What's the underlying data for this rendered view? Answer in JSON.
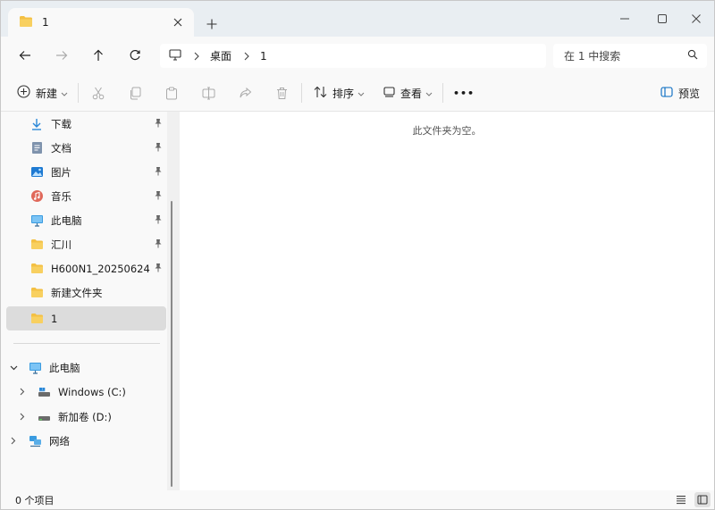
{
  "tab": {
    "title": "1"
  },
  "address": {
    "breadcrumbs": [
      "桌面",
      "1"
    ]
  },
  "search": {
    "placeholder": "在 1 中搜索"
  },
  "toolbar": {
    "new_label": "新建",
    "sort_label": "排序",
    "view_label": "查看",
    "more_label": "•••",
    "preview_label": "预览"
  },
  "sidebar": {
    "quick_access": [
      {
        "label": "下载",
        "icon": "download-icon",
        "pinned": true
      },
      {
        "label": "文档",
        "icon": "document-icon",
        "pinned": true
      },
      {
        "label": "图片",
        "icon": "pictures-icon",
        "pinned": true
      },
      {
        "label": "音乐",
        "icon": "music-icon",
        "pinned": true
      },
      {
        "label": "此电脑",
        "icon": "computer-icon",
        "pinned": true
      },
      {
        "label": "汇川",
        "icon": "folder-icon",
        "pinned": true
      },
      {
        "label": "H600N1_20250624",
        "icon": "folder-icon",
        "pinned": true
      },
      {
        "label": "新建文件夹",
        "icon": "folder-icon",
        "pinned": false
      },
      {
        "label": "1",
        "icon": "folder-icon",
        "pinned": false,
        "selected": true
      }
    ],
    "tree": [
      {
        "label": "此电脑",
        "icon": "computer-icon",
        "expanded": true
      },
      {
        "label": "Windows (C:)",
        "icon": "drive-icon"
      },
      {
        "label": "新加卷 (D:)",
        "icon": "drive-icon"
      },
      {
        "label": "网络",
        "icon": "network-icon"
      }
    ]
  },
  "content": {
    "empty_message": "此文件夹为空。"
  },
  "status": {
    "item_count": "0 个项目"
  },
  "colors": {
    "folder": "#f4c043",
    "accent": "#0067c0",
    "selected_bg": "#dcdcdc"
  }
}
